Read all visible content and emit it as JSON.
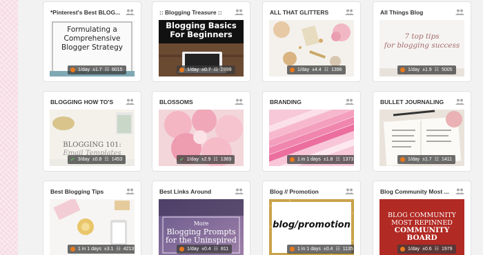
{
  "boards": [
    {
      "title": "*Pinterest's Best BLOG...",
      "thumb_text": [
        "Formulating a",
        "Comprehensive",
        "Blogger Strategy"
      ],
      "status": "ok",
      "frequency": "1/day",
      "score": "±1.7",
      "followers": "6015"
    },
    {
      "title": ":: Blogging Treasure ::",
      "thumb_text": [
        "Blogging Basics",
        "For Beginners"
      ],
      "status": "ok",
      "frequency": "1/day",
      "score": "±0.7",
      "followers": "2899"
    },
    {
      "title": "ALL THAT GLITTERS",
      "thumb_text": [],
      "status": "ok",
      "frequency": "1/day",
      "score": "±4.4",
      "followers": "1396"
    },
    {
      "title": "All Things Blog",
      "thumb_text": [
        "7 top tips",
        "for blogging success"
      ],
      "status": "ok",
      "frequency": "1/day",
      "score": "±1.9",
      "followers": "5005"
    },
    {
      "title": "BLOGGING HOW TO'S",
      "thumb_text": [
        "BLOGGING 101:",
        "Email Templates"
      ],
      "status": "check",
      "frequency": "3/day",
      "score": "±0.8",
      "followers": "1453"
    },
    {
      "title": "BLOSSOMS",
      "thumb_text": [],
      "status": "check",
      "frequency": "1/day",
      "score": "±2.9",
      "followers": "1369"
    },
    {
      "title": "BRANDING",
      "thumb_text": [],
      "status": "ok",
      "frequency": "1 in 1 days",
      "score": "±1.8",
      "followers": "1373"
    },
    {
      "title": "BULLET JOURNALING",
      "thumb_text": [],
      "status": "ok",
      "frequency": "1/day",
      "score": "±1.7",
      "followers": "1411"
    },
    {
      "title": "Best Blogging Tips",
      "thumb_text": [],
      "status": "ok",
      "frequency": "1 in 1 days",
      "score": "±3.1",
      "followers": "4213"
    },
    {
      "title": "Best Links Around",
      "thumb_text": [
        "More",
        "Blogging Prompts",
        "for the Uninspired"
      ],
      "status": "ok",
      "frequency": "1/day",
      "score": "±0.4",
      "followers": "811"
    },
    {
      "title": "Blog // Promotion",
      "thumb_text": [
        "blog/promotion"
      ],
      "status": "ok",
      "frequency": "1 in 1 days",
      "score": "±0.4",
      "followers": "1135"
    },
    {
      "title": "Blog Community Most ...",
      "thumb_text": [
        "BLOG COMMUNITY",
        "MOST REPINNED",
        "COMMUNITY",
        "BOARD"
      ],
      "status": "ok",
      "frequency": "1/day",
      "score": "±0.6",
      "followers": "1979"
    }
  ],
  "icons": {
    "group": "group-icon",
    "status_ok": "status-dot-icon",
    "status_check": "checkmark-icon",
    "followers": "followers-icon"
  },
  "colors": {
    "status_orange": "#e8791c",
    "status_green": "#5fc35f",
    "sidebar_pink": "#f6dbe4"
  }
}
